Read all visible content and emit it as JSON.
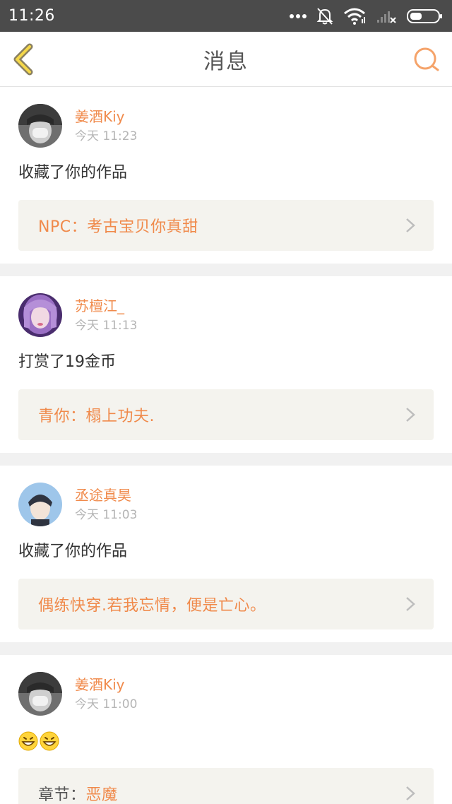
{
  "status_bar": {
    "time": "11:26"
  },
  "header": {
    "title": "消息"
  },
  "colors": {
    "accent": "#f08a4b",
    "card_link_bg": "#f4f3ee",
    "status_bar": "#4b4b4b"
  },
  "messages": [
    {
      "user": "姜酒Kiy",
      "time": "今天 11:23",
      "action": "收藏了你的作品",
      "work": "NPC：考古宝贝你真甜",
      "avatar": "dark-portrait"
    },
    {
      "user": "苏檀江_",
      "time": "今天 11:13",
      "action": "打赏了19金币",
      "work": "青你：榻上功夫.",
      "avatar": "purple-portrait"
    },
    {
      "user": "丞途真昊",
      "time": "今天 11:03",
      "action": "收藏了你的作品",
      "work": "偶练快穿.若我忘情，便是亡心。",
      "avatar": "blue-portrait"
    },
    {
      "user": "姜酒Kiy",
      "time": "今天 11:00",
      "action_emojis": [
        "grinning-face",
        "grinning-face"
      ],
      "work_prefix": "章节：",
      "work": "恶魔",
      "avatar": "dark-portrait"
    }
  ]
}
